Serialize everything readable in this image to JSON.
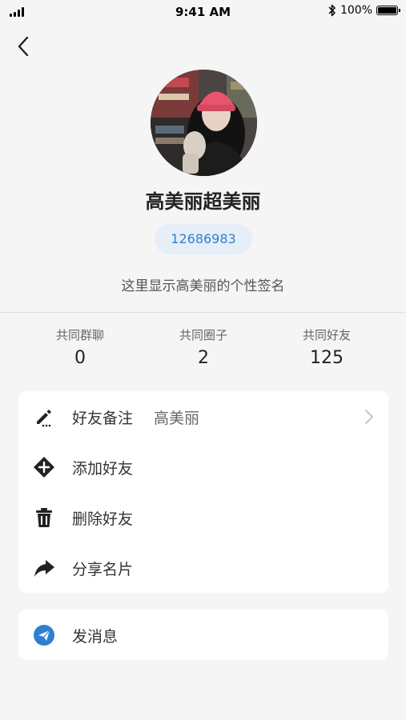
{
  "status_bar": {
    "time": "9:41 AM",
    "battery": "100%"
  },
  "profile": {
    "name": "高美丽超美丽",
    "id": "12686983",
    "signature": "这里显示高美丽的个性签名"
  },
  "stats": [
    {
      "label": "共同群聊",
      "value": "0"
    },
    {
      "label": "共同圈子",
      "value": "2"
    },
    {
      "label": "共同好友",
      "value": "125"
    }
  ],
  "menu": {
    "remark": {
      "label": "好友备注",
      "value": "高美丽",
      "icon": "edit-icon"
    },
    "add": {
      "label": "添加好友",
      "icon": "plus-circle-icon"
    },
    "delete": {
      "label": "删除好友",
      "icon": "trash-icon"
    },
    "share": {
      "label": "分享名片",
      "icon": "share-arrow-icon"
    }
  },
  "message": {
    "label": "发消息",
    "icon": "send-message-icon"
  },
  "colors": {
    "accent": "#2f7fd0",
    "background": "#f5f5f5",
    "badge_bg": "#e6eef7"
  }
}
